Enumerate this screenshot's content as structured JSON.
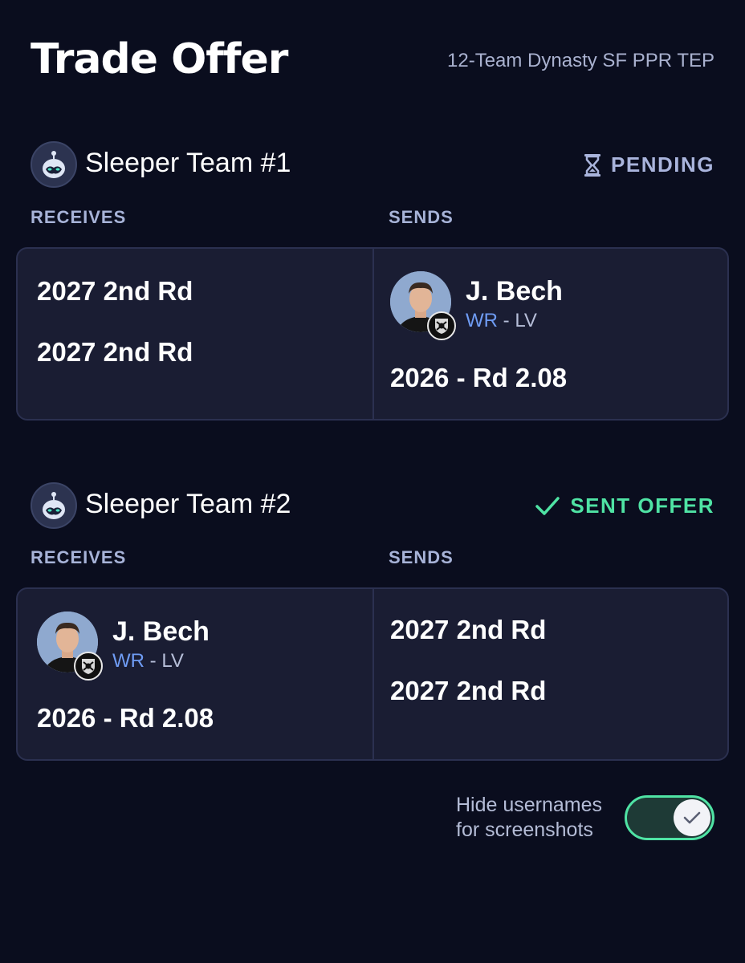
{
  "header": {
    "title": "Trade Offer",
    "league": "12-Team Dynasty SF PPR TEP"
  },
  "teams": [
    {
      "name": "Sleeper Team #1",
      "status": "PENDING",
      "status_icon": "hourglass-icon",
      "receives_label": "RECEIVES",
      "sends_label": "SENDS",
      "receives": [
        "2027 2nd Rd",
        "2027 2nd Rd"
      ],
      "sends_player": {
        "name": "J. Bech",
        "position": "WR",
        "separator": " - ",
        "team": "LV",
        "pick": "2026 - Rd 2.08"
      }
    },
    {
      "name": "Sleeper Team #2",
      "status": "SENT OFFER",
      "status_icon": "checkmark-icon",
      "receives_label": "RECEIVES",
      "sends_label": "SENDS",
      "receives_player": {
        "name": "J. Bech",
        "position": "WR",
        "separator": " - ",
        "team": "LV",
        "pick": "2026 - Rd 2.08"
      },
      "sends": [
        "2027 2nd Rd",
        "2027 2nd Rd"
      ]
    }
  ],
  "toggle": {
    "label_line1": "Hide usernames",
    "label_line2": "for screenshots",
    "checked": true
  },
  "colors": {
    "background": "#0a0d1e",
    "card": "#1a1d33",
    "pending": "#a9b4dc",
    "sent": "#4fe3a4",
    "position": "#6f9cf4"
  }
}
